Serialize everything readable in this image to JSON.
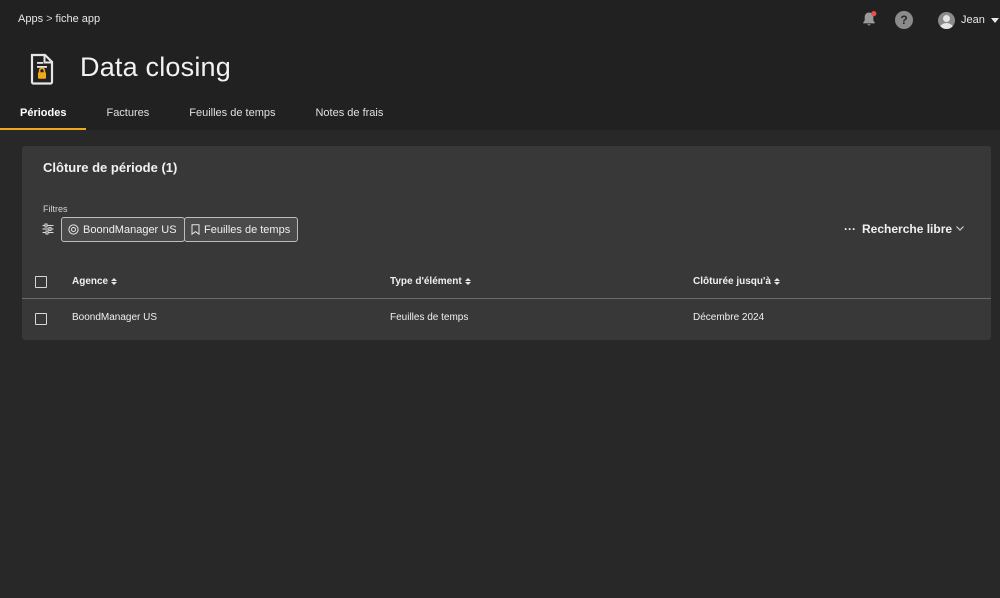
{
  "breadcrumb": {
    "root": "Apps",
    "separator": ">",
    "current": "fiche app"
  },
  "user": {
    "name": "Jean"
  },
  "help": {
    "label": "?"
  },
  "page": {
    "title": "Data closing"
  },
  "tabs": [
    {
      "label": "Périodes",
      "active": true
    },
    {
      "label": "Factures",
      "active": false
    },
    {
      "label": "Feuilles de temps",
      "active": false
    },
    {
      "label": "Notes de frais",
      "active": false
    }
  ],
  "card": {
    "title": "Clôture de période (1)",
    "filters_label": "Filtres",
    "filters": [
      {
        "label": "BoondManager US",
        "icon": "target-icon"
      },
      {
        "label": "Feuilles de temps",
        "icon": "bookmark-icon"
      }
    ],
    "search": {
      "dots": "···",
      "label": "Recherche libre"
    }
  },
  "table": {
    "columns": [
      "Agence",
      "Type d'élément",
      "Clôturée jusqu'à"
    ],
    "rows": [
      [
        "BoondManager US",
        "Feuilles de temps",
        "Décembre 2024"
      ]
    ]
  },
  "colors": {
    "accent": "#f1a91c",
    "notification": "#e84c4c",
    "background": "#282828",
    "card": "#383838"
  }
}
